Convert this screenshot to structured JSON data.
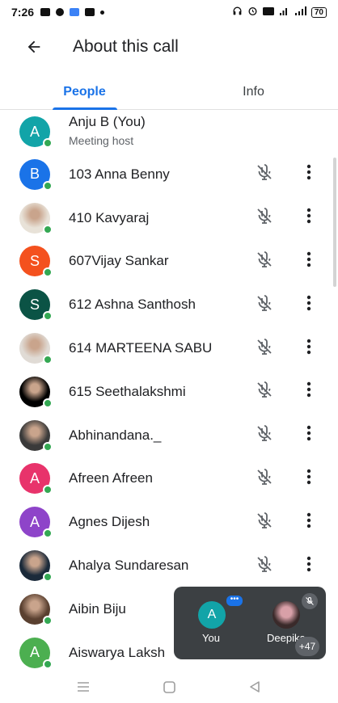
{
  "status_bar": {
    "time": "7:26",
    "battery": "70"
  },
  "app_bar": {
    "title": "About this call"
  },
  "tabs": [
    {
      "label": "People",
      "active": true
    },
    {
      "label": "Info",
      "active": false
    }
  ],
  "host": {
    "initial": "A",
    "name": "Anju B (You)",
    "role": "Meeting host",
    "color": "#12a4a8"
  },
  "participants": [
    {
      "name": "103 Anna Benny",
      "initial": "B",
      "color": "#1a73e8",
      "photo": false
    },
    {
      "name": "410 Kavyaraj",
      "initial": "",
      "color": "#e8e2d8",
      "photo": true
    },
    {
      "name": "607Vijay Sankar",
      "initial": "S",
      "color": "#f4511e",
      "photo": false
    },
    {
      "name": "612 Ashna Santhosh",
      "initial": "S",
      "color": "#0b5345",
      "photo": false
    },
    {
      "name": "614 MARTEENA SABU",
      "initial": "",
      "color": "#e0dbd5",
      "photo": true
    },
    {
      "name": "615 Seethalakshmi",
      "initial": "",
      "color": "#000000",
      "photo": true
    },
    {
      "name": "Abhinandana._",
      "initial": "",
      "color": "#3a3a3a",
      "photo": true
    },
    {
      "name": "Afreen Afreen",
      "initial": "A",
      "color": "#e8336b",
      "photo": false
    },
    {
      "name": "Agnes Dijesh",
      "initial": "A",
      "color": "#8e44c9",
      "photo": false
    },
    {
      "name": "Ahalya Sundaresan",
      "initial": "",
      "color": "#1b2a3a",
      "photo": true
    },
    {
      "name": "Aibin Biju",
      "initial": "",
      "color": "#5a4030",
      "photo": true
    },
    {
      "name": "Aiswarya Laksh",
      "initial": "A",
      "color": "#4caf50",
      "photo": false
    }
  ],
  "pip": {
    "you_initial": "A",
    "you_label": "You",
    "other_label": "Deepika",
    "more_count": "+47"
  }
}
